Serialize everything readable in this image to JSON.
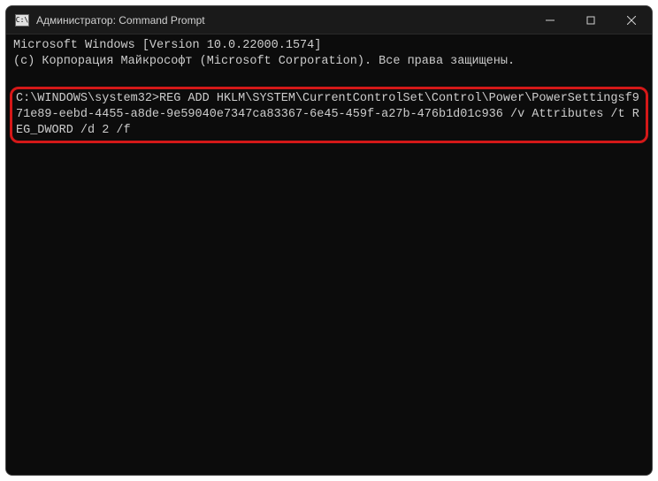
{
  "window": {
    "title": "Администратор: Command Prompt",
    "icon_label": "cmd-icon"
  },
  "window_controls": {
    "minimize_label": "minimize",
    "maximize_label": "maximize",
    "close_label": "close"
  },
  "terminal": {
    "line1": "Microsoft Windows [Version 10.0.22000.1574]",
    "line2": "(c) Корпорация Майкрософт (Microsoft Corporation). Все права защищены.",
    "highlighted_command": "C:\\WINDOWS\\system32>REG ADD HKLM\\SYSTEM\\CurrentControlSet\\Control\\Power\\PowerSettingsf971e89-eebd-4455-a8de-9e59040e7347ca83367-6e45-459f-a27b-476b1d01c936 /v Attributes /t REG_DWORD /d 2 /f"
  }
}
